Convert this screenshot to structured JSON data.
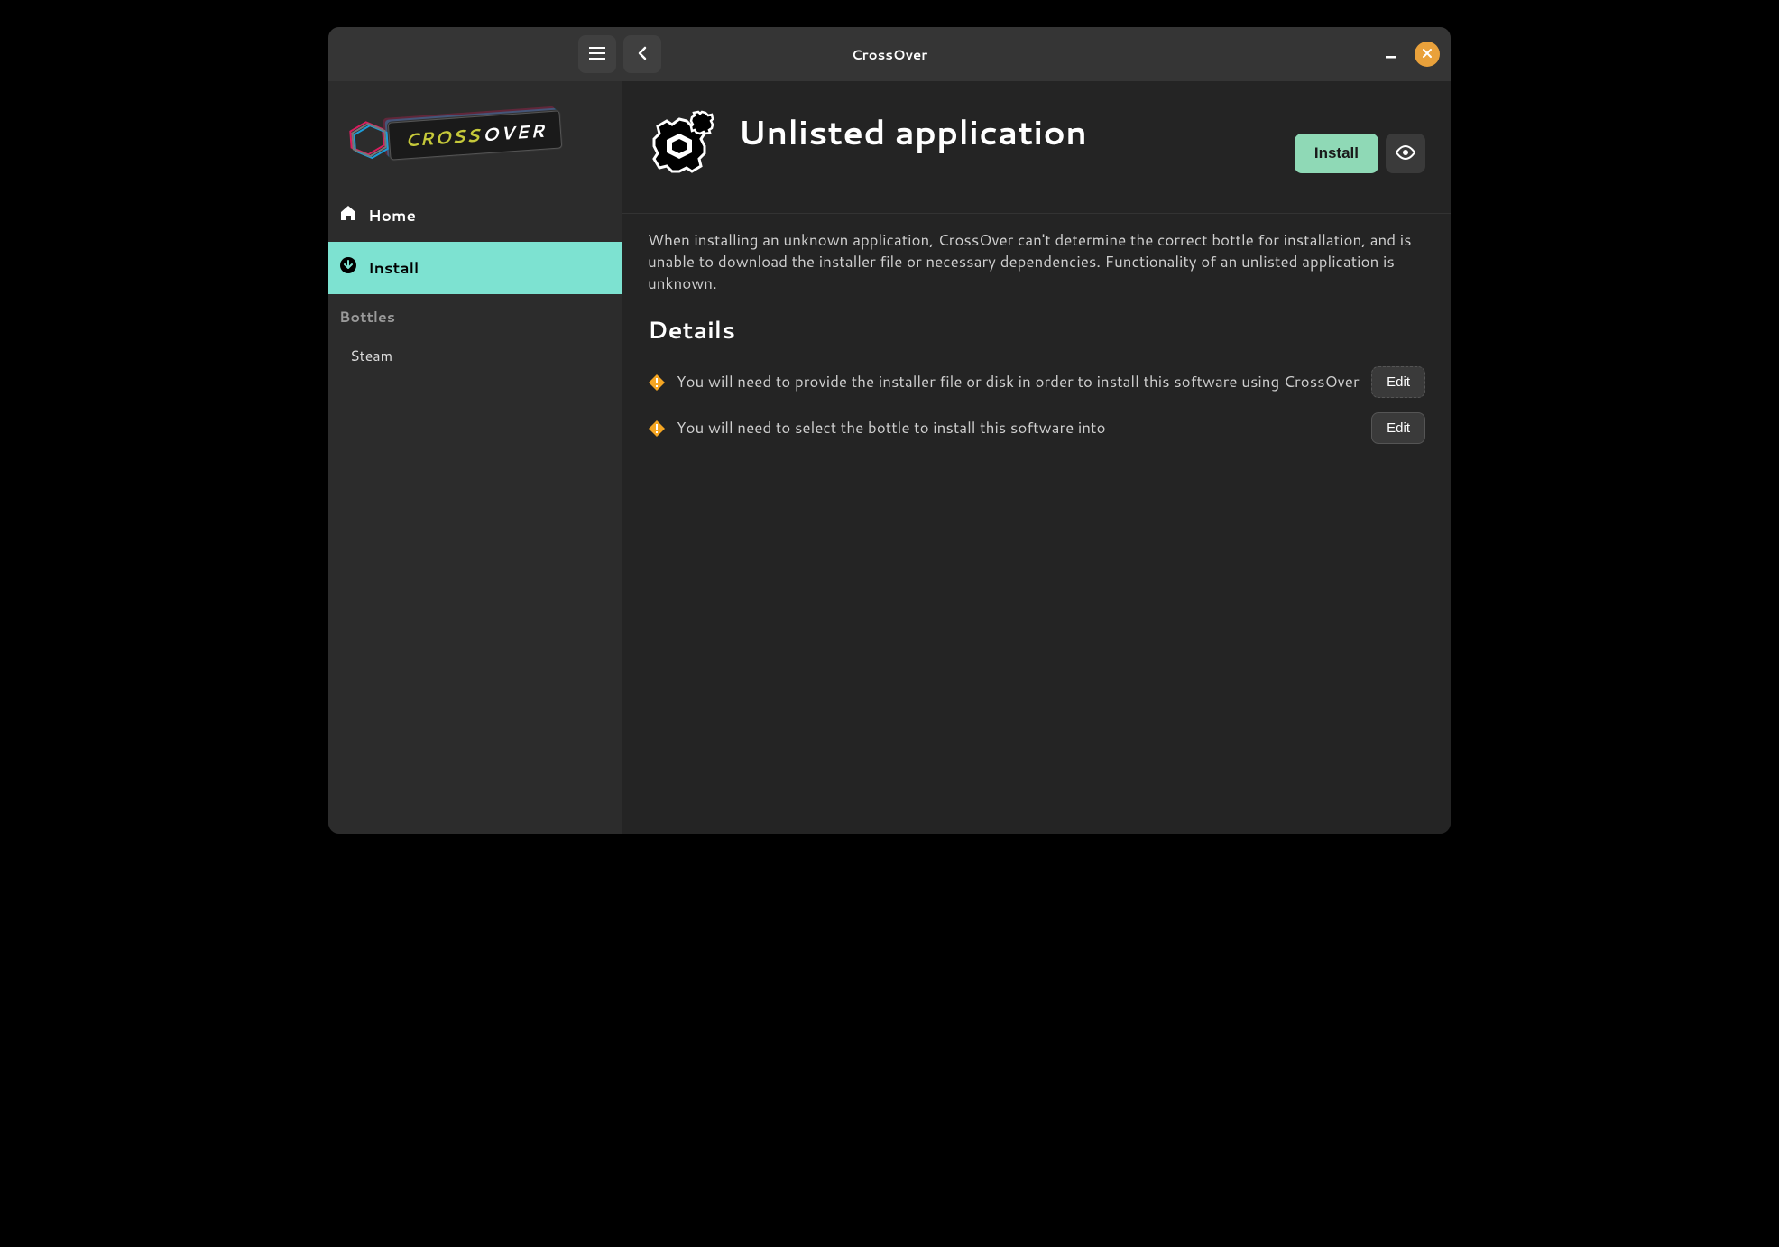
{
  "titlebar": {
    "title": "CrossOver"
  },
  "sidebar": {
    "logo": {
      "left": "CROSS",
      "right": "OVER"
    },
    "nav": {
      "home": "Home",
      "install": "Install"
    },
    "bottles_label": "Bottles",
    "bottles": [
      "Steam"
    ]
  },
  "page": {
    "title": "Unlisted application",
    "install_button": "Install",
    "description": "When installing an unknown application, CrossOver can't determine the correct bottle for installation, and is unable to download the installer file or necessary dependencies. Functionality of an unlisted application is unknown.",
    "details_heading": "Details",
    "details": [
      {
        "text": "You will need to provide the installer file or disk in order to install this software using CrossOver",
        "edit": "Edit"
      },
      {
        "text": "You will need to select the bottle to install this software into",
        "edit": "Edit"
      }
    ]
  }
}
